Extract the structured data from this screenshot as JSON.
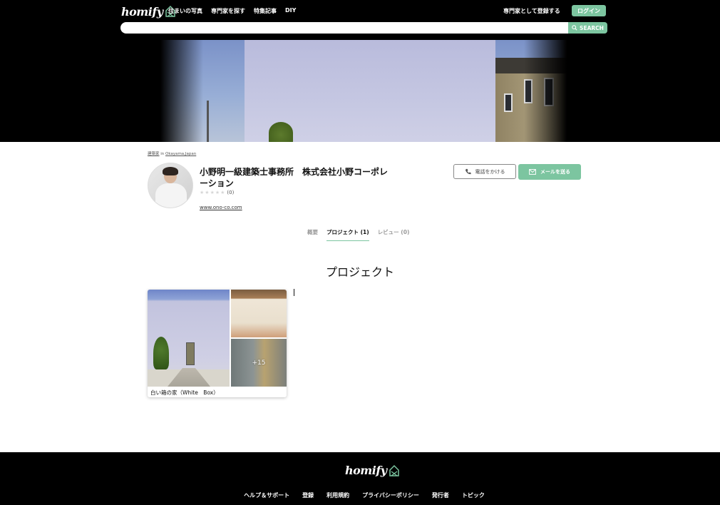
{
  "header": {
    "logo_text": "homify",
    "nav": [
      "住まいの写真",
      "専門家を探す",
      "特集記事",
      "DIY"
    ],
    "pro_register": "専門家として登録する",
    "login": "ログイン",
    "search_placeholder": "",
    "search_button": "SEARCH"
  },
  "profile": {
    "breadcrumb_category": "建築家",
    "breadcrumb_in": " in ",
    "breadcrumb_location": "Okayama,Japan",
    "name": "小野明一級建築士事務所　株式会社小野コーポレーション",
    "rating_count": "(0)",
    "website": "www.ono-co.com",
    "call_button": "電話をかける",
    "mail_button": "メールを送る"
  },
  "tabs": [
    {
      "label": "概要",
      "active": false
    },
    {
      "label": "プロジェクト (1)",
      "active": true
    },
    {
      "label": "レビュー (0)",
      "active": false
    }
  ],
  "projects": {
    "section_title": "プロジェクト",
    "items": [
      {
        "title": "白い箱の家（White　Box）",
        "more_count": "+15"
      }
    ]
  },
  "footer": {
    "logo_text": "homify",
    "links": [
      "ヘルプ＆サポート",
      "登録",
      "利用規約",
      "プライバシーポリシー",
      "発行者",
      "トピック"
    ]
  },
  "colors": {
    "accent": "#7cc5a0",
    "header_bg": "#000000"
  }
}
